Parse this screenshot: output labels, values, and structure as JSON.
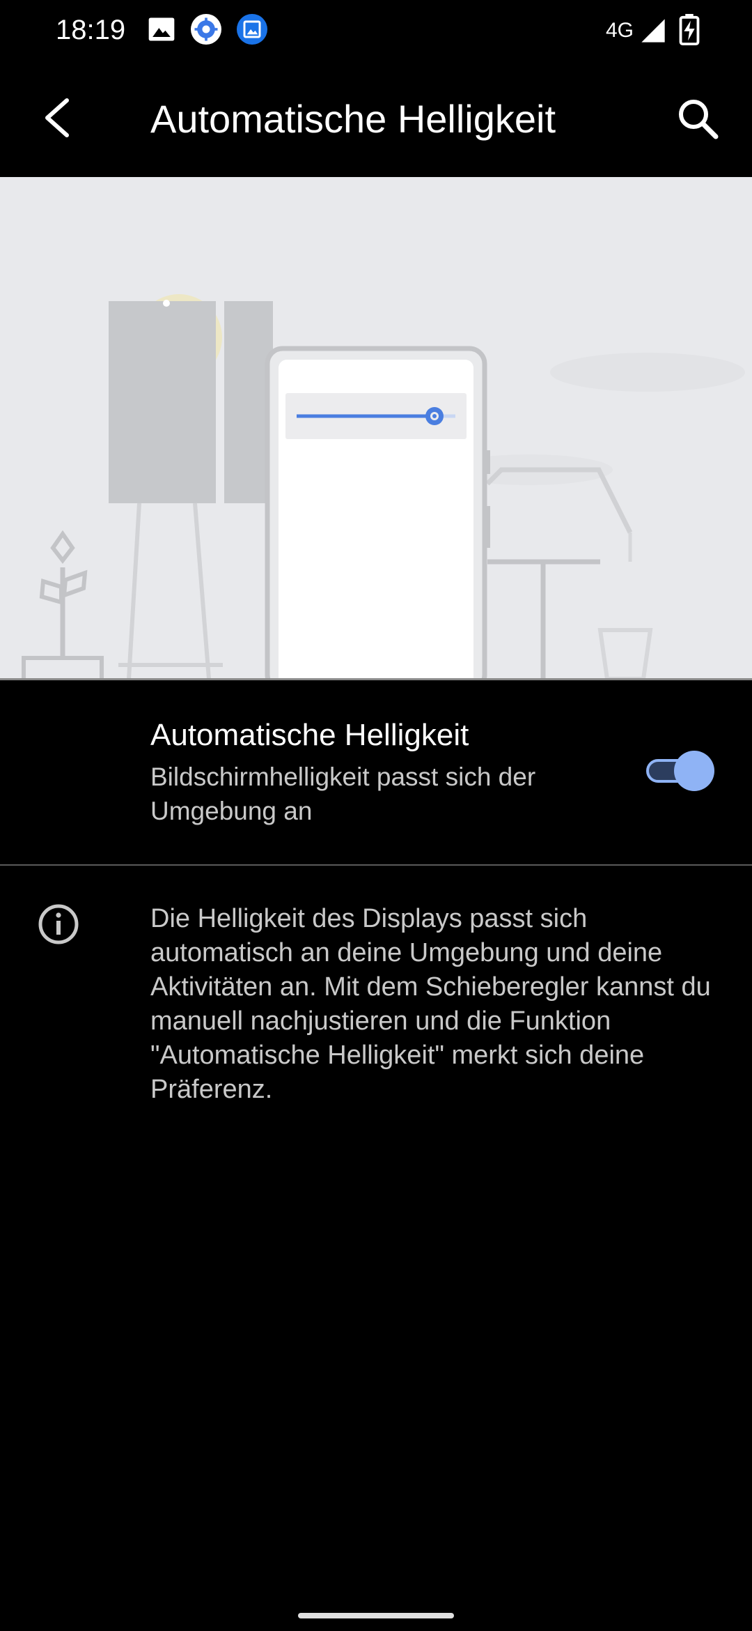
{
  "status_bar": {
    "time": "18:19",
    "network": "4G",
    "icons": [
      "image-icon",
      "settings-gear-icon",
      "gallery-icon",
      "signal-icon",
      "battery-charging-icon"
    ]
  },
  "toolbar": {
    "title": "Automatische Helligkeit",
    "back_icon": "back-arrow-icon",
    "search_icon": "search-icon"
  },
  "illustration": {
    "description_icon": "brightness-illustration",
    "slider_level": 0.86,
    "accent_color": "#4a7ee0"
  },
  "setting": {
    "title": "Automatische Helligkeit",
    "summary": "Bildschirmhelligkeit passt sich der Umgebung an",
    "enabled": true,
    "toggle_color": "#8fb3f5"
  },
  "footer": {
    "icon": "info-icon",
    "text": "Die Helligkeit des Displays passt sich automatisch an deine Umgebung und deine Aktivitäten an. Mit dem Schieberegler kannst du manuell nachjustieren und die Funktion \"Automatische Helligkeit\" merkt sich deine Präferenz."
  }
}
